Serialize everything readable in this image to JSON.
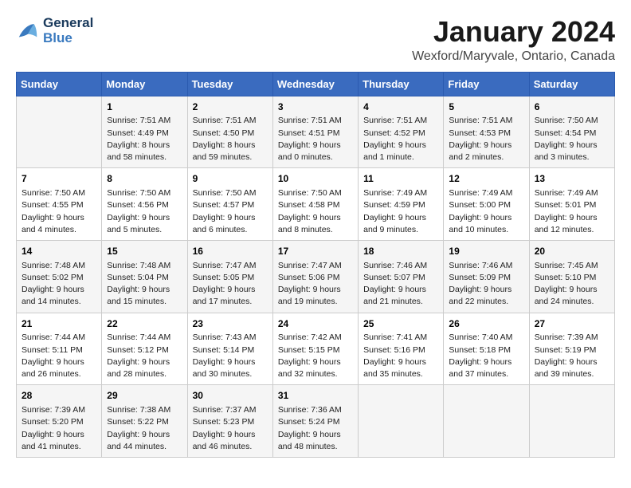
{
  "header": {
    "logo_line1": "General",
    "logo_line2": "Blue",
    "title": "January 2024",
    "subtitle": "Wexford/Maryvale, Ontario, Canada"
  },
  "days": [
    "Sunday",
    "Monday",
    "Tuesday",
    "Wednesday",
    "Thursday",
    "Friday",
    "Saturday"
  ],
  "weeks": [
    [
      {
        "day": "",
        "content": ""
      },
      {
        "day": "1",
        "content": "Sunrise: 7:51 AM\nSunset: 4:49 PM\nDaylight: 8 hours\nand 58 minutes."
      },
      {
        "day": "2",
        "content": "Sunrise: 7:51 AM\nSunset: 4:50 PM\nDaylight: 8 hours\nand 59 minutes."
      },
      {
        "day": "3",
        "content": "Sunrise: 7:51 AM\nSunset: 4:51 PM\nDaylight: 9 hours\nand 0 minutes."
      },
      {
        "day": "4",
        "content": "Sunrise: 7:51 AM\nSunset: 4:52 PM\nDaylight: 9 hours\nand 1 minute."
      },
      {
        "day": "5",
        "content": "Sunrise: 7:51 AM\nSunset: 4:53 PM\nDaylight: 9 hours\nand 2 minutes."
      },
      {
        "day": "6",
        "content": "Sunrise: 7:50 AM\nSunset: 4:54 PM\nDaylight: 9 hours\nand 3 minutes."
      }
    ],
    [
      {
        "day": "7",
        "content": "Sunrise: 7:50 AM\nSunset: 4:55 PM\nDaylight: 9 hours\nand 4 minutes."
      },
      {
        "day": "8",
        "content": "Sunrise: 7:50 AM\nSunset: 4:56 PM\nDaylight: 9 hours\nand 5 minutes."
      },
      {
        "day": "9",
        "content": "Sunrise: 7:50 AM\nSunset: 4:57 PM\nDaylight: 9 hours\nand 6 minutes."
      },
      {
        "day": "10",
        "content": "Sunrise: 7:50 AM\nSunset: 4:58 PM\nDaylight: 9 hours\nand 8 minutes."
      },
      {
        "day": "11",
        "content": "Sunrise: 7:49 AM\nSunset: 4:59 PM\nDaylight: 9 hours\nand 9 minutes."
      },
      {
        "day": "12",
        "content": "Sunrise: 7:49 AM\nSunset: 5:00 PM\nDaylight: 9 hours\nand 10 minutes."
      },
      {
        "day": "13",
        "content": "Sunrise: 7:49 AM\nSunset: 5:01 PM\nDaylight: 9 hours\nand 12 minutes."
      }
    ],
    [
      {
        "day": "14",
        "content": "Sunrise: 7:48 AM\nSunset: 5:02 PM\nDaylight: 9 hours\nand 14 minutes."
      },
      {
        "day": "15",
        "content": "Sunrise: 7:48 AM\nSunset: 5:04 PM\nDaylight: 9 hours\nand 15 minutes."
      },
      {
        "day": "16",
        "content": "Sunrise: 7:47 AM\nSunset: 5:05 PM\nDaylight: 9 hours\nand 17 minutes."
      },
      {
        "day": "17",
        "content": "Sunrise: 7:47 AM\nSunset: 5:06 PM\nDaylight: 9 hours\nand 19 minutes."
      },
      {
        "day": "18",
        "content": "Sunrise: 7:46 AM\nSunset: 5:07 PM\nDaylight: 9 hours\nand 21 minutes."
      },
      {
        "day": "19",
        "content": "Sunrise: 7:46 AM\nSunset: 5:09 PM\nDaylight: 9 hours\nand 22 minutes."
      },
      {
        "day": "20",
        "content": "Sunrise: 7:45 AM\nSunset: 5:10 PM\nDaylight: 9 hours\nand 24 minutes."
      }
    ],
    [
      {
        "day": "21",
        "content": "Sunrise: 7:44 AM\nSunset: 5:11 PM\nDaylight: 9 hours\nand 26 minutes."
      },
      {
        "day": "22",
        "content": "Sunrise: 7:44 AM\nSunset: 5:12 PM\nDaylight: 9 hours\nand 28 minutes."
      },
      {
        "day": "23",
        "content": "Sunrise: 7:43 AM\nSunset: 5:14 PM\nDaylight: 9 hours\nand 30 minutes."
      },
      {
        "day": "24",
        "content": "Sunrise: 7:42 AM\nSunset: 5:15 PM\nDaylight: 9 hours\nand 32 minutes."
      },
      {
        "day": "25",
        "content": "Sunrise: 7:41 AM\nSunset: 5:16 PM\nDaylight: 9 hours\nand 35 minutes."
      },
      {
        "day": "26",
        "content": "Sunrise: 7:40 AM\nSunset: 5:18 PM\nDaylight: 9 hours\nand 37 minutes."
      },
      {
        "day": "27",
        "content": "Sunrise: 7:39 AM\nSunset: 5:19 PM\nDaylight: 9 hours\nand 39 minutes."
      }
    ],
    [
      {
        "day": "28",
        "content": "Sunrise: 7:39 AM\nSunset: 5:20 PM\nDaylight: 9 hours\nand 41 minutes."
      },
      {
        "day": "29",
        "content": "Sunrise: 7:38 AM\nSunset: 5:22 PM\nDaylight: 9 hours\nand 44 minutes."
      },
      {
        "day": "30",
        "content": "Sunrise: 7:37 AM\nSunset: 5:23 PM\nDaylight: 9 hours\nand 46 minutes."
      },
      {
        "day": "31",
        "content": "Sunrise: 7:36 AM\nSunset: 5:24 PM\nDaylight: 9 hours\nand 48 minutes."
      },
      {
        "day": "",
        "content": ""
      },
      {
        "day": "",
        "content": ""
      },
      {
        "day": "",
        "content": ""
      }
    ]
  ]
}
